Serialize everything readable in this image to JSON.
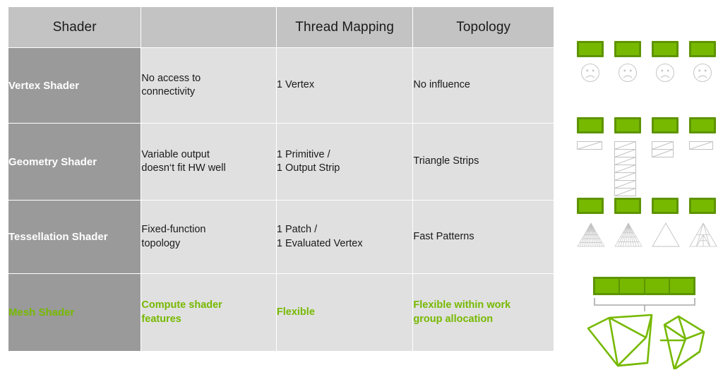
{
  "table": {
    "headers": [
      {
        "label": "Shader",
        "name": "header-shader"
      },
      {
        "label": "",
        "name": "header-feature"
      },
      {
        "label": "Thread Mapping",
        "name": "header-thread-mapping"
      },
      {
        "label": "Topology",
        "name": "header-topology"
      }
    ],
    "rows": [
      {
        "shader": "Vertex Shader",
        "feature_line1": "No access to",
        "feature_line2": "connectivity",
        "thread_line1": "1 Vertex",
        "thread_line2": "",
        "topology_line1": "No influence",
        "topology_line2": "",
        "highlight": false
      },
      {
        "shader": "Geometry Shader",
        "feature_line1": "Variable output",
        "feature_line2": "doesn‘t fit HW well",
        "thread_line1": "1 Primitive /",
        "thread_line2": "1 Output Strip",
        "topology_line1": "Triangle Strips",
        "topology_line2": "",
        "highlight": false
      },
      {
        "shader": "Tessellation Shader",
        "feature_line1": "Fixed-function",
        "feature_line2": "topology",
        "thread_line1": "1 Patch /",
        "thread_line2": "1 Evaluated Vertex",
        "topology_line1": "Fast Patterns",
        "topology_line2": "",
        "highlight": false
      },
      {
        "shader": "Mesh Shader",
        "feature_line1": "Compute shader",
        "feature_line2": "features",
        "thread_line1": "Flexible",
        "thread_line2": "",
        "topology_line1": "Flexible within work",
        "topology_line2": "group allocation",
        "highlight": true
      }
    ]
  },
  "diagram": {
    "rows": [
      {
        "name": "vertex-shader-illustration",
        "kind": "faces",
        "thread_boxes": 4,
        "items": [
          "sad-face",
          "sad-face",
          "sad-face",
          "sad-face"
        ]
      },
      {
        "name": "geometry-shader-illustration",
        "kind": "strips",
        "thread_boxes": 4,
        "strip_segments": [
          1,
          7,
          2,
          1
        ]
      },
      {
        "name": "tessellation-shader-illustration",
        "kind": "triangles",
        "thread_boxes": 4,
        "tessellation_levels": [
          6,
          5,
          1,
          2
        ]
      },
      {
        "name": "mesh-shader-illustration",
        "kind": "meshlets",
        "work_group_segments": 4,
        "meshlets": 2
      }
    ]
  },
  "colors": {
    "nvidia_green": "#76b900",
    "green_border": "#5e9400",
    "header_gray": "#c3c3c3",
    "shader_col_gray": "#9a9a9a",
    "body_gray": "#e0e0e0",
    "outline_gray": "#b5b5b5",
    "text_dark": "#1a1a1a",
    "text_white": "#ffffff"
  }
}
